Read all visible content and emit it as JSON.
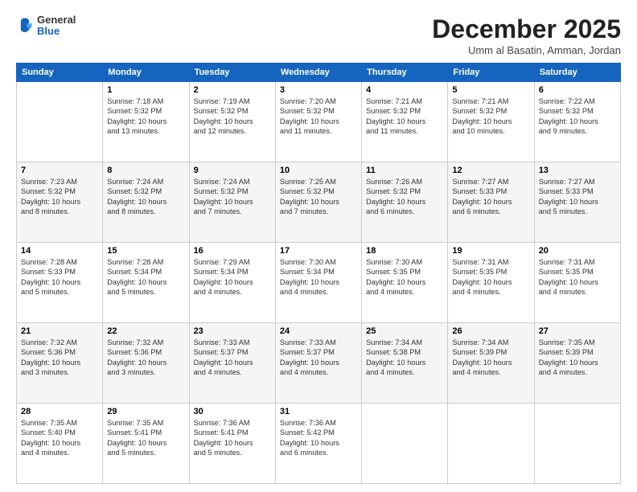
{
  "logo": {
    "general": "General",
    "blue": "Blue"
  },
  "header": {
    "month": "December 2025",
    "location": "Umm al Basatin, Amman, Jordan"
  },
  "weekdays": [
    "Sunday",
    "Monday",
    "Tuesday",
    "Wednesday",
    "Thursday",
    "Friday",
    "Saturday"
  ],
  "weeks": [
    [
      {
        "date": "",
        "info": ""
      },
      {
        "date": "1",
        "info": "Sunrise: 7:18 AM\nSunset: 5:32 PM\nDaylight: 10 hours\nand 13 minutes."
      },
      {
        "date": "2",
        "info": "Sunrise: 7:19 AM\nSunset: 5:32 PM\nDaylight: 10 hours\nand 12 minutes."
      },
      {
        "date": "3",
        "info": "Sunrise: 7:20 AM\nSunset: 5:32 PM\nDaylight: 10 hours\nand 11 minutes."
      },
      {
        "date": "4",
        "info": "Sunrise: 7:21 AM\nSunset: 5:32 PM\nDaylight: 10 hours\nand 11 minutes."
      },
      {
        "date": "5",
        "info": "Sunrise: 7:21 AM\nSunset: 5:32 PM\nDaylight: 10 hours\nand 10 minutes."
      },
      {
        "date": "6",
        "info": "Sunrise: 7:22 AM\nSunset: 5:32 PM\nDaylight: 10 hours\nand 9 minutes."
      }
    ],
    [
      {
        "date": "7",
        "info": "Sunrise: 7:23 AM\nSunset: 5:32 PM\nDaylight: 10 hours\nand 8 minutes."
      },
      {
        "date": "8",
        "info": "Sunrise: 7:24 AM\nSunset: 5:32 PM\nDaylight: 10 hours\nand 8 minutes."
      },
      {
        "date": "9",
        "info": "Sunrise: 7:24 AM\nSunset: 5:32 PM\nDaylight: 10 hours\nand 7 minutes."
      },
      {
        "date": "10",
        "info": "Sunrise: 7:25 AM\nSunset: 5:32 PM\nDaylight: 10 hours\nand 7 minutes."
      },
      {
        "date": "11",
        "info": "Sunrise: 7:26 AM\nSunset: 5:32 PM\nDaylight: 10 hours\nand 6 minutes."
      },
      {
        "date": "12",
        "info": "Sunrise: 7:27 AM\nSunset: 5:33 PM\nDaylight: 10 hours\nand 6 minutes."
      },
      {
        "date": "13",
        "info": "Sunrise: 7:27 AM\nSunset: 5:33 PM\nDaylight: 10 hours\nand 5 minutes."
      }
    ],
    [
      {
        "date": "14",
        "info": "Sunrise: 7:28 AM\nSunset: 5:33 PM\nDaylight: 10 hours\nand 5 minutes."
      },
      {
        "date": "15",
        "info": "Sunrise: 7:28 AM\nSunset: 5:34 PM\nDaylight: 10 hours\nand 5 minutes."
      },
      {
        "date": "16",
        "info": "Sunrise: 7:29 AM\nSunset: 5:34 PM\nDaylight: 10 hours\nand 4 minutes."
      },
      {
        "date": "17",
        "info": "Sunrise: 7:30 AM\nSunset: 5:34 PM\nDaylight: 10 hours\nand 4 minutes."
      },
      {
        "date": "18",
        "info": "Sunrise: 7:30 AM\nSunset: 5:35 PM\nDaylight: 10 hours\nand 4 minutes."
      },
      {
        "date": "19",
        "info": "Sunrise: 7:31 AM\nSunset: 5:35 PM\nDaylight: 10 hours\nand 4 minutes."
      },
      {
        "date": "20",
        "info": "Sunrise: 7:31 AM\nSunset: 5:35 PM\nDaylight: 10 hours\nand 4 minutes."
      }
    ],
    [
      {
        "date": "21",
        "info": "Sunrise: 7:32 AM\nSunset: 5:36 PM\nDaylight: 10 hours\nand 3 minutes."
      },
      {
        "date": "22",
        "info": "Sunrise: 7:32 AM\nSunset: 5:36 PM\nDaylight: 10 hours\nand 3 minutes."
      },
      {
        "date": "23",
        "info": "Sunrise: 7:33 AM\nSunset: 5:37 PM\nDaylight: 10 hours\nand 4 minutes."
      },
      {
        "date": "24",
        "info": "Sunrise: 7:33 AM\nSunset: 5:37 PM\nDaylight: 10 hours\nand 4 minutes."
      },
      {
        "date": "25",
        "info": "Sunrise: 7:34 AM\nSunset: 5:38 PM\nDaylight: 10 hours\nand 4 minutes."
      },
      {
        "date": "26",
        "info": "Sunrise: 7:34 AM\nSunset: 5:39 PM\nDaylight: 10 hours\nand 4 minutes."
      },
      {
        "date": "27",
        "info": "Sunrise: 7:35 AM\nSunset: 5:39 PM\nDaylight: 10 hours\nand 4 minutes."
      }
    ],
    [
      {
        "date": "28",
        "info": "Sunrise: 7:35 AM\nSunset: 5:40 PM\nDaylight: 10 hours\nand 4 minutes."
      },
      {
        "date": "29",
        "info": "Sunrise: 7:35 AM\nSunset: 5:41 PM\nDaylight: 10 hours\nand 5 minutes."
      },
      {
        "date": "30",
        "info": "Sunrise: 7:36 AM\nSunset: 5:41 PM\nDaylight: 10 hours\nand 5 minutes."
      },
      {
        "date": "31",
        "info": "Sunrise: 7:36 AM\nSunset: 5:42 PM\nDaylight: 10 hours\nand 6 minutes."
      },
      {
        "date": "",
        "info": ""
      },
      {
        "date": "",
        "info": ""
      },
      {
        "date": "",
        "info": ""
      }
    ]
  ]
}
